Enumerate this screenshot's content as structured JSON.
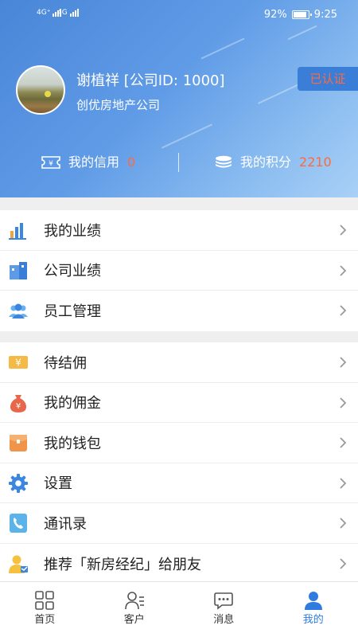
{
  "status_bar": {
    "signal1": "4G⁺",
    "signal2": "4G",
    "battery": "92%",
    "time": "9:25"
  },
  "profile": {
    "name": "谢植祥 [公司ID: 1000]",
    "company": "创优房地产公司",
    "badge": "已认证"
  },
  "stats": {
    "credit_label": "我的信用",
    "credit_value": "0",
    "points_label": "我的积分",
    "points_value": "2210"
  },
  "menu_group1": [
    {
      "label": "我的业绩",
      "icon": "bar-chart-icon"
    },
    {
      "label": "公司业绩",
      "icon": "building-icon"
    },
    {
      "label": "员工管理",
      "icon": "staff-icon"
    }
  ],
  "menu_group2": [
    {
      "label": "待结佣",
      "icon": "yen-tag-icon"
    },
    {
      "label": "我的佣金",
      "icon": "money-bag-icon"
    },
    {
      "label": "我的钱包",
      "icon": "wallet-icon"
    },
    {
      "label": "设置",
      "icon": "gear-icon"
    },
    {
      "label": "通讯录",
      "icon": "phone-book-icon"
    },
    {
      "label": "推荐「新房经纪」给朋友",
      "icon": "recommend-user-icon"
    }
  ],
  "tabs": [
    {
      "label": "首页",
      "icon": "grid-icon"
    },
    {
      "label": "客户",
      "icon": "customer-icon"
    },
    {
      "label": "消息",
      "icon": "chat-icon"
    },
    {
      "label": "我的",
      "icon": "person-icon"
    }
  ],
  "colors": {
    "accent": "#2f7be0",
    "highlight": "#ff6a3d",
    "header_start": "#4a86d8"
  }
}
